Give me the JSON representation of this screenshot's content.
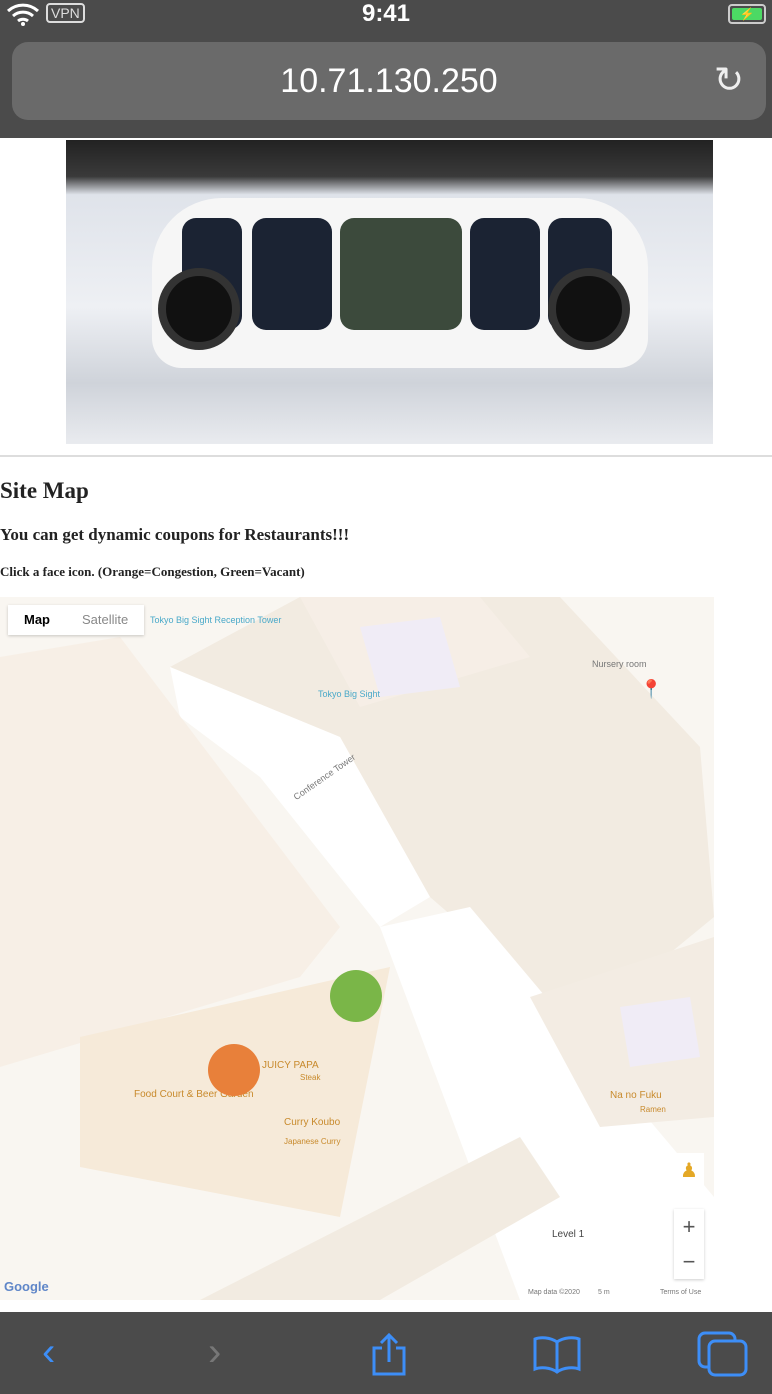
{
  "status_bar": {
    "time": "9:41",
    "vpn": "VPN"
  },
  "browser": {
    "url": "10.71.130.250"
  },
  "page": {
    "heading": "Site Map",
    "subheading": "You can get dynamic coupons for Restaurants!!!",
    "instructions": "Click a face icon. (Orange=Congestion, Green=Vacant)"
  },
  "map": {
    "type_buttons": [
      "Map",
      "Satellite"
    ],
    "places": [
      "Tokyo Big Sight Reception Tower",
      "Tokyo Big Sight",
      "Nursery room",
      "JUICY PAPA",
      "Steak",
      "Food Court & Beer Garden",
      "Curry Koubo",
      "Japanese Curry",
      "Na no Fuku",
      "Ramen",
      "Conference Tower"
    ],
    "level": "Level 1",
    "zoom_in": "+",
    "zoom_out": "−",
    "logo": "Google",
    "footer": [
      "Map data ©2020",
      "5 m",
      "Terms of Use"
    ],
    "faces": [
      {
        "status": "Vacant",
        "color": "#7ab648"
      },
      {
        "status": "Congestion",
        "color": "#e8803a"
      }
    ]
  },
  "toolbar": {
    "icons": [
      "back-icon",
      "forward-icon",
      "share-icon",
      "bookmarks-icon",
      "tabs-icon"
    ]
  }
}
